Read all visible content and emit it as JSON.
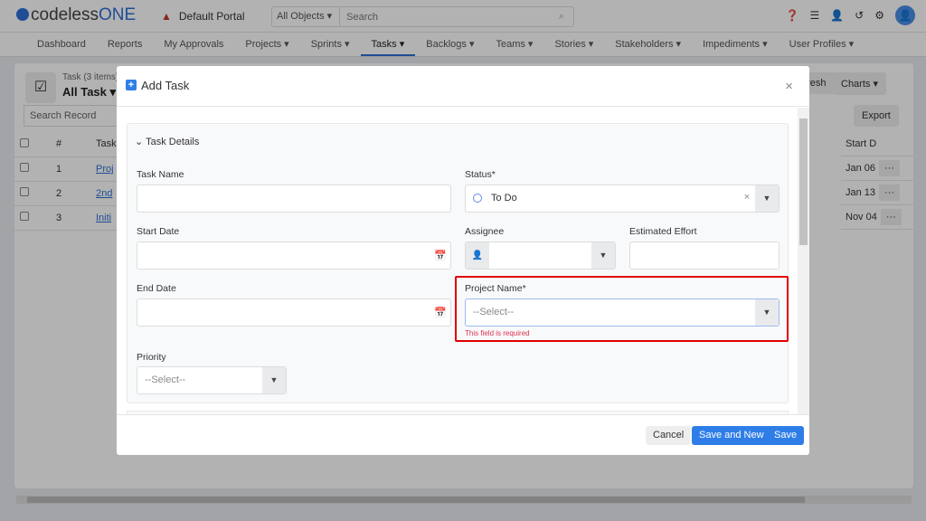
{
  "header": {
    "logo_a": "codeless",
    "logo_b": "ONE",
    "portal": "Default Portal",
    "search_scope": "All Objects",
    "search_placeholder": "Search"
  },
  "nav": [
    "Dashboard",
    "Reports",
    "My Approvals",
    "Projects ▾",
    "Sprints ▾",
    "Tasks ▾",
    "Backlogs ▾",
    "Teams ▾",
    "Stories ▾",
    "Stakeholders ▾",
    "Impediments ▾",
    "User Profiles ▾"
  ],
  "list": {
    "subtitle": "Task (3 items)",
    "title": "All Task ▾",
    "search": "Search Record",
    "refresh": "Refresh",
    "charts": "Charts ▾",
    "export": "Export",
    "columns": [
      "#",
      "Task Name",
      "Start D"
    ],
    "rows": [
      {
        "n": "1",
        "name": "Proj",
        "start": "Jan 06"
      },
      {
        "n": "2",
        "name": "2nd",
        "start": "Jan 13"
      },
      {
        "n": "3",
        "name": "Initi",
        "start": "Nov 04"
      }
    ]
  },
  "modal": {
    "title": "Add Task",
    "section": "Task Details",
    "task_name": "Task Name",
    "status": "Status*",
    "status_value": "To Do",
    "start_date": "Start Date",
    "assignee": "Assignee",
    "effort": "Estimated Effort",
    "end_date": "End Date",
    "project": "Project Name*",
    "project_placeholder": "--Select--",
    "error": "This field is required",
    "priority": "Priority",
    "priority_placeholder": "--Select--",
    "cancel": "Cancel",
    "save_new": "Save and New",
    "save": "Save"
  },
  "colors": {
    "accent": "#2f7ee8",
    "error": "#e00000"
  }
}
